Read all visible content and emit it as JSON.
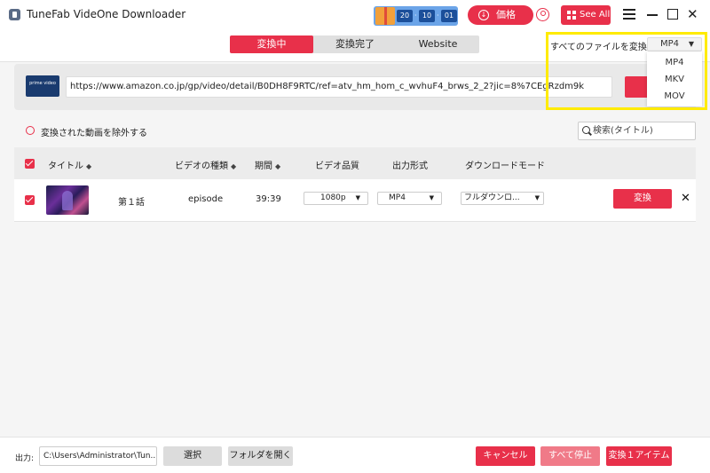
{
  "window": {
    "title": "TuneFab VideOne Downloader",
    "promo_counts": [
      "20",
      "10",
      "01"
    ],
    "price_label": "価格",
    "see_all_label": "See All"
  },
  "tabs": [
    {
      "label": "変換中",
      "active": true
    },
    {
      "label": "変換完了",
      "active": false
    },
    {
      "label": "Website",
      "active": false
    }
  ],
  "convert_all": {
    "label": "すべてのファイルを変換:",
    "selected": "MP4",
    "options": [
      "MP4",
      "MKV",
      "MOV"
    ]
  },
  "url_bar": {
    "logo_text": "prime video",
    "url": "https://www.amazon.co.jp/gp/video/detail/B0DH8F9RTC/ref=atv_hm_hom_c_wvhuF4_brws_2_2?jic=8%7CEgRzdm9k"
  },
  "filter": {
    "exclude_label": "変換された動画を除外する",
    "search_placeholder": "検索(タイトル)"
  },
  "table": {
    "columns": {
      "title": "タイトル",
      "video_type": "ビデオの種類",
      "duration": "期間",
      "quality": "ビデオ品質",
      "format": "出力形式",
      "download_mode": "ダウンロードモード"
    },
    "rows": [
      {
        "title": "第１話",
        "video_type": "episode",
        "duration": "39:39",
        "quality": "1080p",
        "format": "MP4",
        "download_mode": "フルダウンロ...",
        "action": "変換"
      }
    ]
  },
  "bottom": {
    "output_label": "出力:",
    "output_path": "C:\\Users\\Administrator\\Tun...",
    "select_label": "選択",
    "open_folder_label": "フォルダを開く",
    "cancel_label": "キャンセル",
    "stop_all_label": "すべて停止",
    "convert_items_label": "変換１アイテム"
  },
  "colors": {
    "accent": "#e8304a",
    "highlight": "#ffeb00"
  }
}
